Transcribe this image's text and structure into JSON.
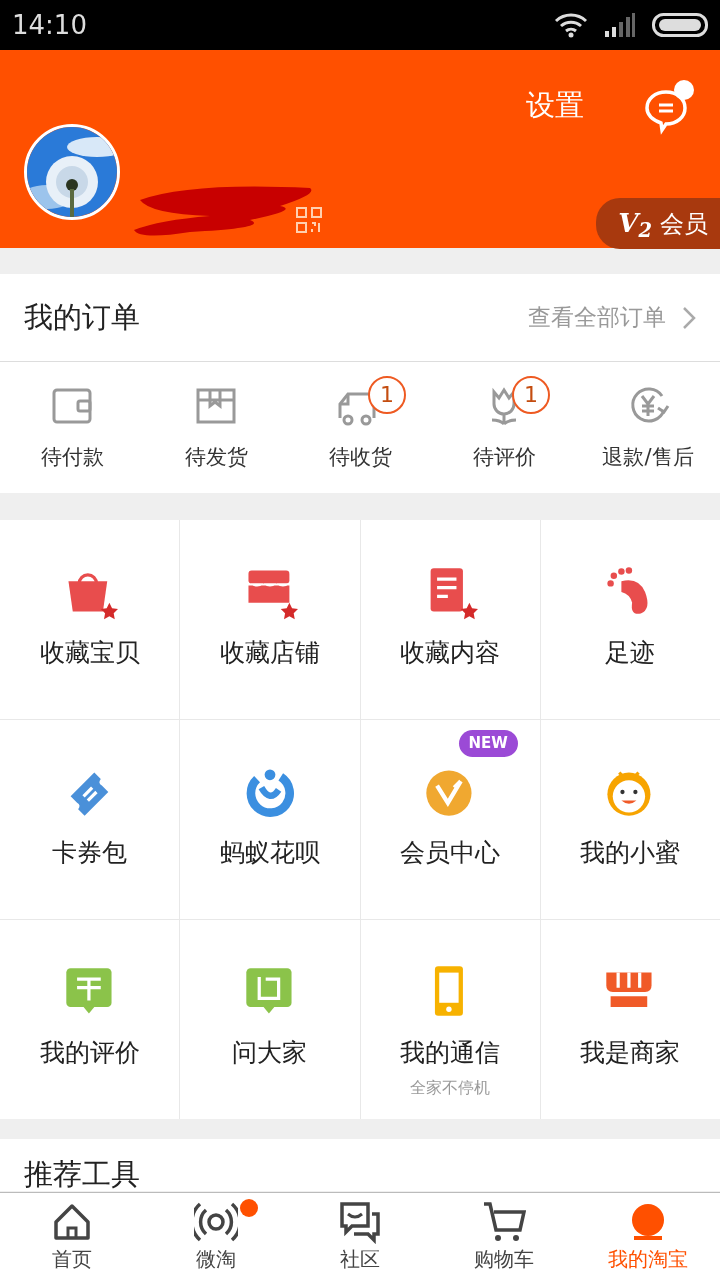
{
  "status_bar": {
    "time": "14:10"
  },
  "header": {
    "settings": "设置",
    "messages_unread": true,
    "member_badge": "V$_{2}$",
    "member_label": "会员"
  },
  "orders": {
    "title": "我的订单",
    "view_all": "查看全部订单",
    "items": [
      {
        "label": "待付款"
      },
      {
        "label": "待发货"
      },
      {
        "label": "待收货",
        "count": "1"
      },
      {
        "label": "待评价",
        "count": "1"
      },
      {
        "label": "退款/售后"
      }
    ]
  },
  "services": [
    {
      "label": "收藏宝贝"
    },
    {
      "label": "收藏店铺"
    },
    {
      "label": "收藏内容"
    },
    {
      "label": "足迹"
    },
    {
      "label": "卡券包"
    },
    {
      "label": "蚂蚁花呗"
    },
    {
      "label": "会员中心",
      "badge": "NEW"
    },
    {
      "label": "我的小蜜"
    },
    {
      "label": "我的评价"
    },
    {
      "label": "问大家"
    },
    {
      "label": "我的通信",
      "subtitle": "全家不停机"
    },
    {
      "label": "我是商家"
    }
  ],
  "recommended_title": "推荐工具",
  "tab_bar": [
    {
      "label": "首页",
      "selected": false,
      "dot": false
    },
    {
      "label": "微淘",
      "selected": false,
      "dot": true
    },
    {
      "label": "社区",
      "selected": false,
      "dot": false
    },
    {
      "label": "购物车",
      "selected": false,
      "dot": false
    },
    {
      "label": "我的淘宝",
      "selected": true,
      "dot": false
    }
  ]
}
